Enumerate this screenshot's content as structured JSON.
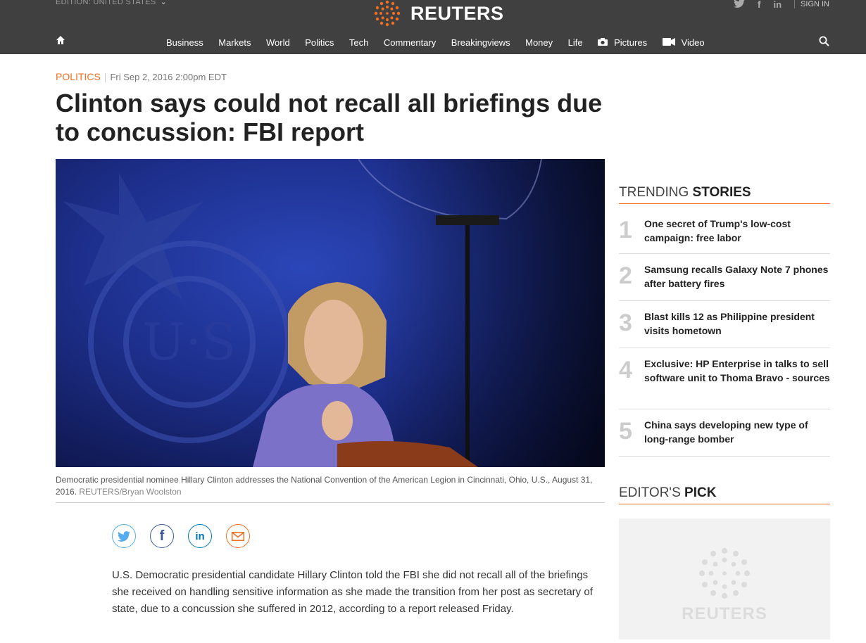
{
  "header": {
    "edition": "EDITION: UNITED STATES",
    "brand": "REUTERS",
    "signin": "SIGN IN",
    "nav": [
      {
        "label": "Business",
        "icon": ""
      },
      {
        "label": "Markets",
        "icon": ""
      },
      {
        "label": "World",
        "icon": ""
      },
      {
        "label": "Politics",
        "icon": ""
      },
      {
        "label": "Tech",
        "icon": ""
      },
      {
        "label": "Commentary",
        "icon": ""
      },
      {
        "label": "Breakingviews",
        "icon": ""
      },
      {
        "label": "Money",
        "icon": ""
      },
      {
        "label": "Life",
        "icon": ""
      },
      {
        "label": "Pictures",
        "icon": "camera-icon"
      },
      {
        "label": "Video",
        "icon": "video-icon"
      }
    ]
  },
  "article": {
    "section": "POLITICS",
    "date": "Fri Sep 2, 2016 2:00pm EDT",
    "headline": "Clinton says could not recall all briefings due to concussion: FBI report",
    "caption": "Democratic presidential nominee Hillary Clinton addresses the National Convention of the American Legion in Cincinnati, Ohio, U.S., August 31, 2016.",
    "credit": "REUTERS/Bryan Woolston",
    "body": "U.S. Democratic presidential candidate Hillary Clinton told the FBI she did not recall all of the briefings she received on handling sensitive information as she made the transition from her post as secretary of state, due to a concussion she suffered in 2012, according to a report released Friday."
  },
  "sidebar": {
    "trending_light": "TRENDING",
    "trending_bold": "STORIES",
    "trending": [
      {
        "num": "1",
        "title": "One secret of Trump's low-cost campaign: free labor"
      },
      {
        "num": "2",
        "title": "Samsung recalls Galaxy Note 7 phones after battery fires"
      },
      {
        "num": "3",
        "title": "Blast kills 12 as Philippine president visits hometown"
      },
      {
        "num": "4",
        "title": "Exclusive: HP Enterprise in talks to sell software unit to Thoma Bravo - sources"
      },
      {
        "num": "5",
        "title": "China says developing new type of long-range bomber"
      }
    ],
    "pick_light": "EDITOR'S",
    "pick_bold": "PICK",
    "pick_brand": "REUTERS"
  },
  "colors": {
    "accent": "#f26f21",
    "topbar": "#404040",
    "twitter": "#55acee",
    "facebook": "#3b5998",
    "linkedin": "#0077b5",
    "email": "#f26f21"
  }
}
